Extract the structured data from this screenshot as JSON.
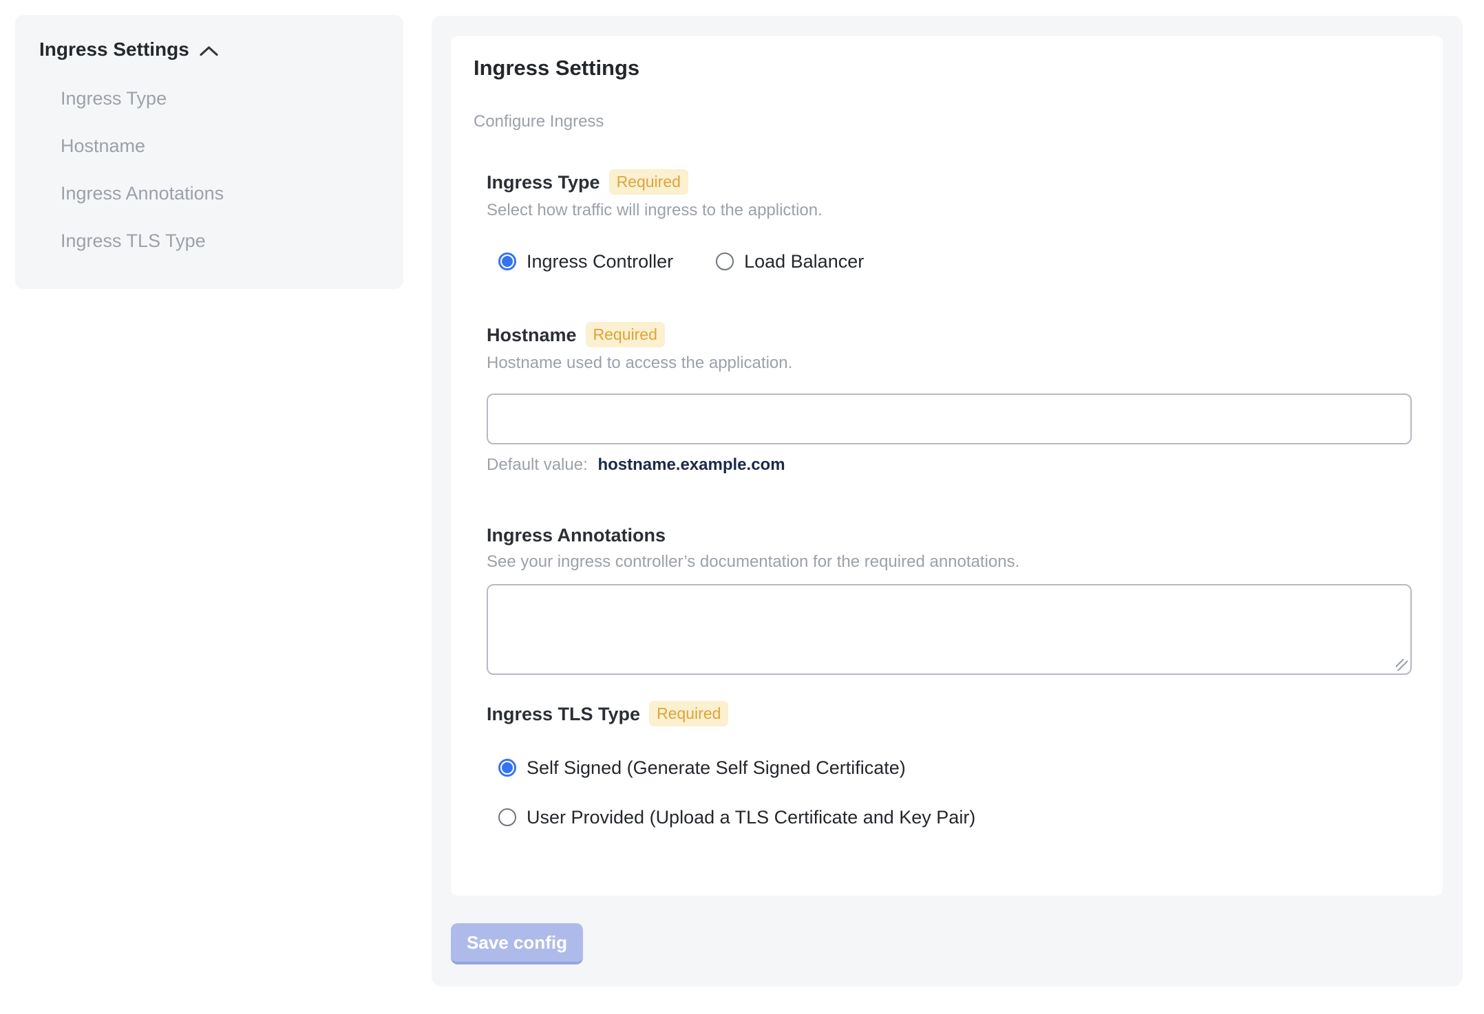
{
  "colors": {
    "accent_blue": "#3574f0",
    "panel_bg": "#f5f6f8",
    "badge_bg": "#fbf0cf",
    "badge_text": "#dda43c",
    "save_button_bg": "#aebbea",
    "default_value_text": "#1b2a4a",
    "muted_text": "#9ba1a8"
  },
  "icons": {
    "sidebar_collapse": "chevron-up"
  },
  "sidebar": {
    "title": "Ingress Settings",
    "items": [
      {
        "label": "Ingress Type"
      },
      {
        "label": "Hostname"
      },
      {
        "label": "Ingress Annotations"
      },
      {
        "label": "Ingress TLS Type"
      }
    ]
  },
  "main": {
    "title": "Ingress Settings",
    "subtitle": "Configure Ingress",
    "sections": {
      "ingress_type": {
        "label": "Ingress Type",
        "required": "Required",
        "description": "Select how traffic will ingress to the appliction.",
        "options": [
          {
            "label": "Ingress Controller",
            "selected": true
          },
          {
            "label": "Load Balancer",
            "selected": false
          }
        ]
      },
      "hostname": {
        "label": "Hostname",
        "required": "Required",
        "description": "Hostname used to access the application.",
        "input_value": "",
        "default_label": "Default value:",
        "default_value": "hostname.example.com"
      },
      "annotations": {
        "label": "Ingress Annotations",
        "description": "See your ingress controller’s documentation for the required annotations.",
        "value": ""
      },
      "tls": {
        "label": "Ingress TLS Type",
        "required": "Required",
        "options": [
          {
            "label": "Self Signed (Generate Self Signed Certificate)",
            "selected": true
          },
          {
            "label": "User Provided (Upload a TLS Certificate and Key Pair)",
            "selected": false
          }
        ]
      }
    },
    "save_button": {
      "label": "Save config"
    }
  }
}
